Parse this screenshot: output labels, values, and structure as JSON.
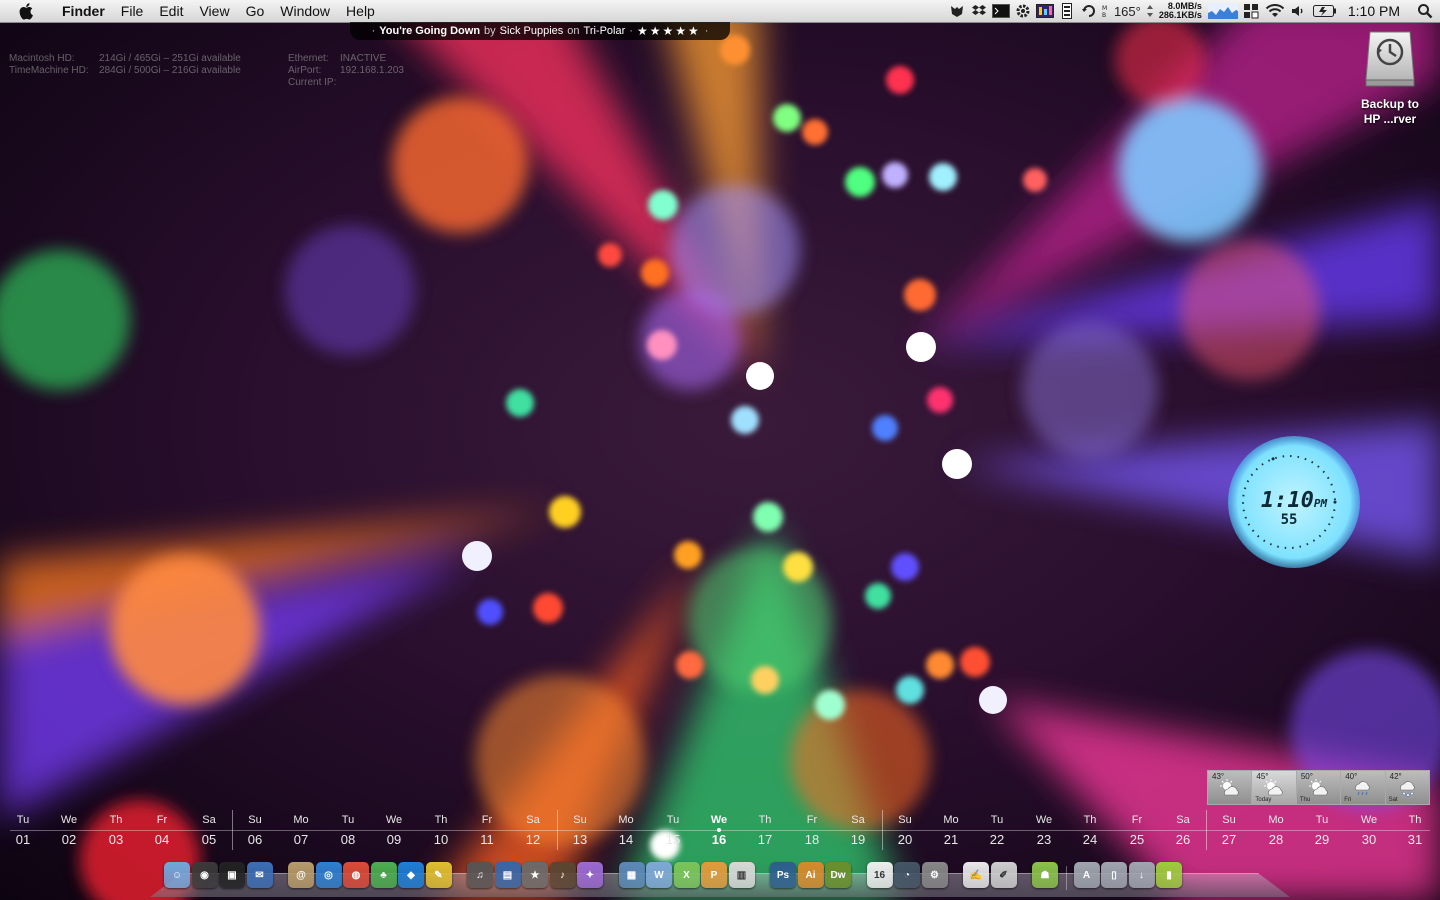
{
  "menubar": {
    "app": "Finder",
    "menus": [
      "File",
      "Edit",
      "View",
      "Go",
      "Window",
      "Help"
    ],
    "status": {
      "temperature": "165°",
      "net_down": "8.0MB/s",
      "net_up": "286.1KB/s",
      "clock": "1:10 PM"
    }
  },
  "now_playing": {
    "song": "You're Going Down",
    "by": "by",
    "artist": "Sick Puppies",
    "on": "on",
    "album": "Tri-Polar",
    "rating": "★★★★★"
  },
  "geektool": {
    "disks": [
      {
        "name": "Macintosh HD:",
        "info": "214Gi / 465Gi – 251Gi available"
      },
      {
        "name": "TimeMachine HD:",
        "info": "284Gi / 500Gi – 216Gi available"
      }
    ],
    "network": [
      {
        "label": "Ethernet:",
        "value": "INACTIVE"
      },
      {
        "label": "AirPort:",
        "value": "192.168.1.203"
      },
      {
        "label": "Current IP:",
        "value": ""
      }
    ]
  },
  "desktop_icon": {
    "line1": "Backup to",
    "line2": "HP ...rver"
  },
  "clock_widget": {
    "time": "1:10",
    "ampm": "PM",
    "seconds": "55"
  },
  "weather": {
    "days": [
      {
        "temp": "43°",
        "name": "",
        "icon": "partly-cloudy-icon"
      },
      {
        "temp": "45°",
        "name": "Today",
        "icon": "partly-cloudy-icon"
      },
      {
        "temp": "50°",
        "name": "Thu",
        "icon": "partly-cloudy-icon"
      },
      {
        "temp": "40°",
        "name": "Fri",
        "icon": "rain-icon"
      },
      {
        "temp": "42°",
        "name": "Sat",
        "icon": "snow-icon"
      }
    ]
  },
  "calendar": {
    "today": "16",
    "days": [
      {
        "dow": "Tu",
        "num": "01"
      },
      {
        "dow": "We",
        "num": "02"
      },
      {
        "dow": "Th",
        "num": "03"
      },
      {
        "dow": "Fr",
        "num": "04"
      },
      {
        "dow": "Sa",
        "num": "05"
      },
      {
        "dow": "Su",
        "num": "06"
      },
      {
        "dow": "Mo",
        "num": "07"
      },
      {
        "dow": "Tu",
        "num": "08"
      },
      {
        "dow": "We",
        "num": "09"
      },
      {
        "dow": "Th",
        "num": "10"
      },
      {
        "dow": "Fr",
        "num": "11"
      },
      {
        "dow": "Sa",
        "num": "12"
      },
      {
        "dow": "Su",
        "num": "13"
      },
      {
        "dow": "Mo",
        "num": "14"
      },
      {
        "dow": "Tu",
        "num": "15"
      },
      {
        "dow": "We",
        "num": "16"
      },
      {
        "dow": "Th",
        "num": "17"
      },
      {
        "dow": "Fr",
        "num": "18"
      },
      {
        "dow": "Sa",
        "num": "19"
      },
      {
        "dow": "Su",
        "num": "20"
      },
      {
        "dow": "Mo",
        "num": "21"
      },
      {
        "dow": "Tu",
        "num": "22"
      },
      {
        "dow": "We",
        "num": "23"
      },
      {
        "dow": "Th",
        "num": "24"
      },
      {
        "dow": "Fr",
        "num": "25"
      },
      {
        "dow": "Sa",
        "num": "26"
      },
      {
        "dow": "Su",
        "num": "27"
      },
      {
        "dow": "Mo",
        "num": "28"
      },
      {
        "dow": "Tu",
        "num": "29"
      },
      {
        "dow": "We",
        "num": "30"
      },
      {
        "dow": "Th",
        "num": "31"
      }
    ]
  },
  "dock": {
    "items": [
      {
        "name": "finder-icon",
        "color": "#6fa8dc",
        "glyph": "☺"
      },
      {
        "name": "dashboard-icon",
        "color": "#3a3a3a",
        "glyph": "◉"
      },
      {
        "name": "photo-booth-icon",
        "color": "#222222",
        "glyph": "▣"
      },
      {
        "name": "mail-icon",
        "color": "#3d6fb6",
        "glyph": "✉"
      },
      {
        "name": "address-book-icon",
        "color": "#b89c6a",
        "glyph": "@"
      },
      {
        "name": "safari-icon",
        "color": "#2f80d1",
        "glyph": "◎"
      },
      {
        "name": "chrome-icon",
        "color": "#dd4b39",
        "glyph": "◍"
      },
      {
        "name": "adium-icon",
        "color": "#4caf50",
        "glyph": "♣"
      },
      {
        "name": "dropbox-icon",
        "color": "#1f7fd6",
        "glyph": "◆"
      },
      {
        "name": "notes-icon",
        "color": "#e0c030",
        "glyph": "✎"
      },
      {
        "name": "itunes-icon",
        "color": "#555555",
        "glyph": "♫"
      },
      {
        "name": "iphoto-icon",
        "color": "#3567a8",
        "glyph": "▤"
      },
      {
        "name": "imovie-icon",
        "color": "#6a6a6a",
        "glyph": "★"
      },
      {
        "name": "garageband-icon",
        "color": "#5a4632",
        "glyph": "♪"
      },
      {
        "name": "pixelmator-icon",
        "color": "#9c6bd3",
        "glyph": "✦"
      },
      {
        "name": "preview-icon",
        "color": "#5d89b7",
        "glyph": "▦"
      },
      {
        "name": "word-icon",
        "color": "#7fa7d8",
        "glyph": "W"
      },
      {
        "name": "excel-icon",
        "color": "#7cc35a",
        "glyph": "X"
      },
      {
        "name": "powerpoint-icon",
        "color": "#e29a3c",
        "glyph": "P"
      },
      {
        "name": "entourage-icon",
        "color": "#d8d8d8",
        "glyph": "▥"
      },
      {
        "name": "photoshop-icon",
        "color": "#2e5d8e",
        "glyph": "Ps"
      },
      {
        "name": "illustrator-icon",
        "color": "#d7892b",
        "glyph": "Ai"
      },
      {
        "name": "dreamweaver-icon",
        "color": "#6a8f2a",
        "glyph": "Dw"
      },
      {
        "name": "ical-icon",
        "color": "#eeeeee",
        "glyph": "16"
      },
      {
        "name": "time-machine-icon",
        "color": "#445566",
        "glyph": "◔"
      },
      {
        "name": "system-preferences-icon",
        "color": "#888888",
        "glyph": "⚙"
      },
      {
        "name": "text-edit-icon",
        "color": "#e8e8e8",
        "glyph": "✍"
      },
      {
        "name": "script-editor-icon",
        "color": "#cfcfcf",
        "glyph": "✐"
      },
      {
        "name": "android-icon",
        "color": "#8bc34a",
        "glyph": "☗"
      },
      {
        "name": "applications-folder-icon",
        "color": "#a0a6b0",
        "glyph": "A"
      },
      {
        "name": "documents-folder-icon",
        "color": "#a0a6b0",
        "glyph": "▯"
      },
      {
        "name": "downloads-folder-icon",
        "color": "#a0a6b0",
        "glyph": "↓"
      },
      {
        "name": "trash-icon",
        "color": "#9ccc3c",
        "glyph": "▮"
      }
    ]
  }
}
